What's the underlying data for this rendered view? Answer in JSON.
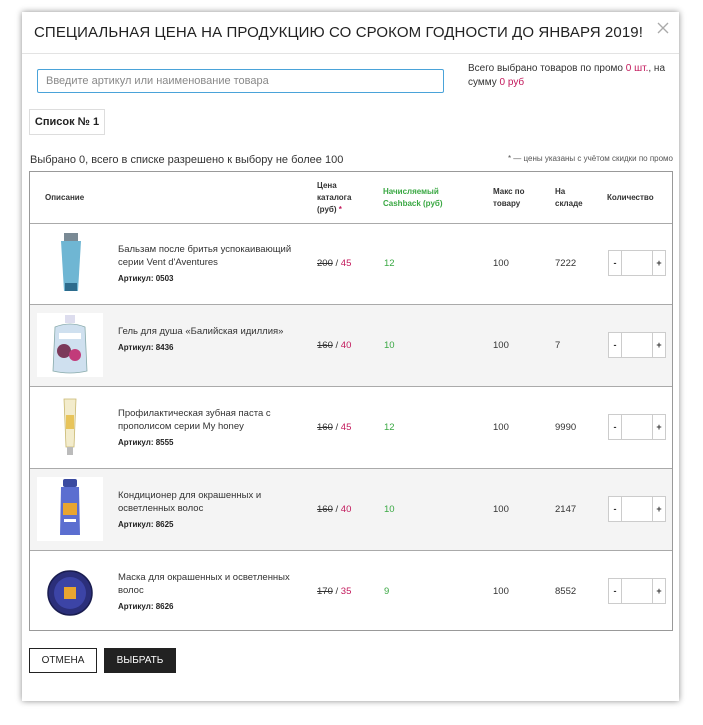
{
  "dialog": {
    "title": "СПЕЦИАЛЬНАЯ ЦЕНА НА ПРОДУКЦИЮ СО СРОКОМ ГОДНОСТИ ДО ЯНВАРЯ 2019!",
    "close_icon": "close-icon"
  },
  "search": {
    "placeholder": "Введите артикул или наименование товара",
    "value": ""
  },
  "promo_summary": {
    "text_before": "Всего выбрано товаров по промо ",
    "count": "0 шт.",
    "text_middle": ", на сумму ",
    "sum": "0 руб"
  },
  "list_tab": {
    "label": "Список № 1"
  },
  "selection": {
    "info": "Выбрано 0, всего в списке разрешено к выбору не более 100",
    "note": "* — цены указаны с учётом скидки по промо"
  },
  "table": {
    "headers": {
      "description": "Описание",
      "price_line1": "Цена",
      "price_line2": "каталога",
      "price_line3": "(руб)",
      "price_star": " *",
      "cashback_line1": "Начисляемый",
      "cashback_line2": "Cashback (руб)",
      "max_line1": "Макс по",
      "max_line2": "товару",
      "stock_line1": "На",
      "stock_line2": "складе",
      "quantity": "Количество"
    },
    "rows": [
      {
        "name": "Бальзам после бритья успокаивающий серии Vent d'Aventures",
        "sku": "Артикул: 0503",
        "old_price": "200",
        "sep": " / ",
        "new_price": "45",
        "cashback": "12",
        "max": "100",
        "stock": "7222",
        "qty_minus": "-",
        "qty_plus": "+",
        "qty_value": ""
      },
      {
        "name": "Гель для душа «Балийская идиллия»",
        "sku": "Артикул: 8436",
        "old_price": "160",
        "sep": " / ",
        "new_price": "40",
        "cashback": "10",
        "max": "100",
        "stock": "7",
        "qty_minus": "-",
        "qty_plus": "+",
        "qty_value": ""
      },
      {
        "name": "Профилактическая зубная паста с прополисом серии My honey",
        "sku": "Артикул: 8555",
        "old_price": "160",
        "sep": " / ",
        "new_price": "45",
        "cashback": "12",
        "max": "100",
        "stock": "9990",
        "qty_minus": "-",
        "qty_plus": "+",
        "qty_value": ""
      },
      {
        "name": "Кондиционер для окрашенных и осветленных волос",
        "sku": "Артикул: 8625",
        "old_price": "160",
        "sep": " / ",
        "new_price": "40",
        "cashback": "10",
        "max": "100",
        "stock": "2147",
        "qty_minus": "-",
        "qty_plus": "+",
        "qty_value": ""
      },
      {
        "name": "Маска для окрашенных и осветленных волос",
        "sku": "Артикул: 8626",
        "old_price": "170",
        "sep": " / ",
        "new_price": "35",
        "cashback": "9",
        "max": "100",
        "stock": "8552",
        "qty_minus": "-",
        "qty_plus": "+",
        "qty_value": ""
      }
    ]
  },
  "buttons": {
    "cancel": "ОТМЕНА",
    "select": "ВЫБРАТЬ"
  },
  "colors": {
    "accent_price": "#c2185b",
    "cashback_green": "#3aa843",
    "search_border": "#4aa3d9",
    "primary_button": "#222222"
  }
}
